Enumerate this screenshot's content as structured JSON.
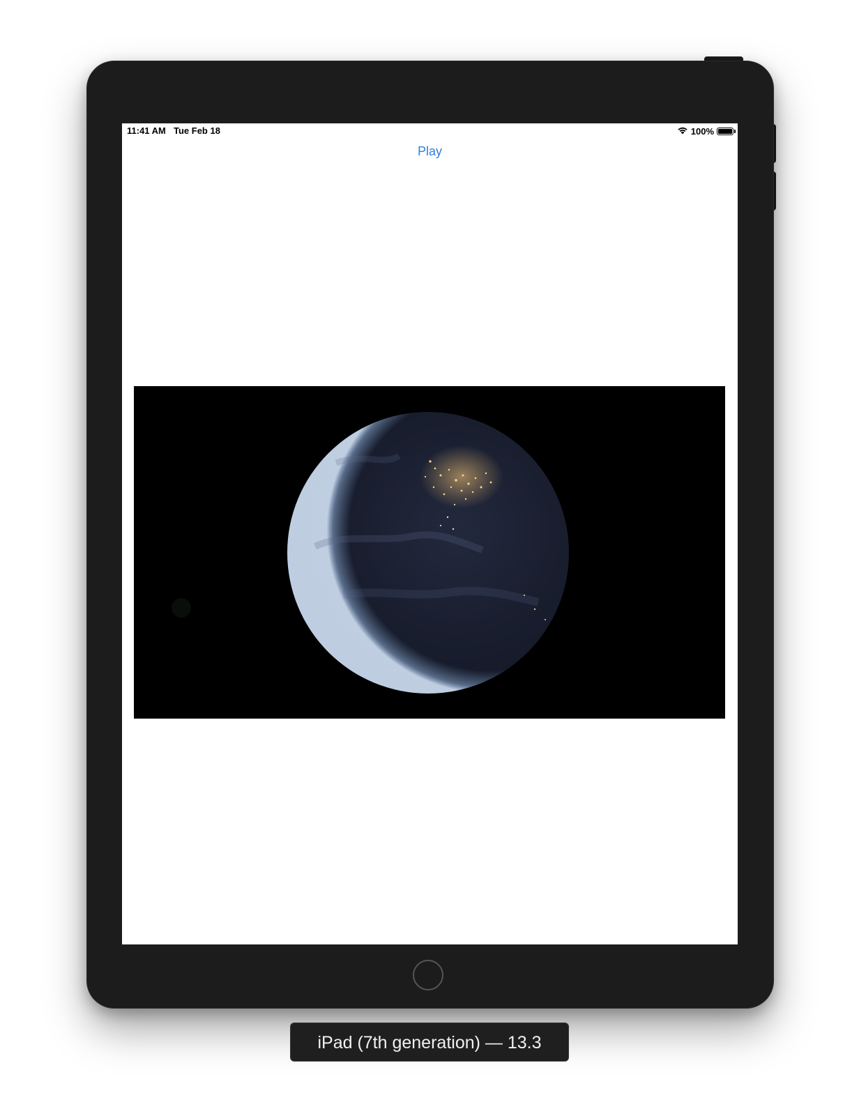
{
  "status_bar": {
    "time": "11:41 AM",
    "date": "Tue Feb 18",
    "battery_percent": "100%",
    "battery_level": 1.0
  },
  "app": {
    "play_label": "Play"
  },
  "video": {
    "content": "earth-at-night-globe-image"
  },
  "device_caption": "iPad (7th generation) — 13.3",
  "colors": {
    "device_body": "#1c1c1c",
    "screen_background": "#ffffff",
    "play_tint": "#2f7fe0",
    "video_background": "#000000"
  },
  "icons": {
    "wifi": "wifi-icon",
    "battery": "battery-icon",
    "home": "home-button"
  }
}
